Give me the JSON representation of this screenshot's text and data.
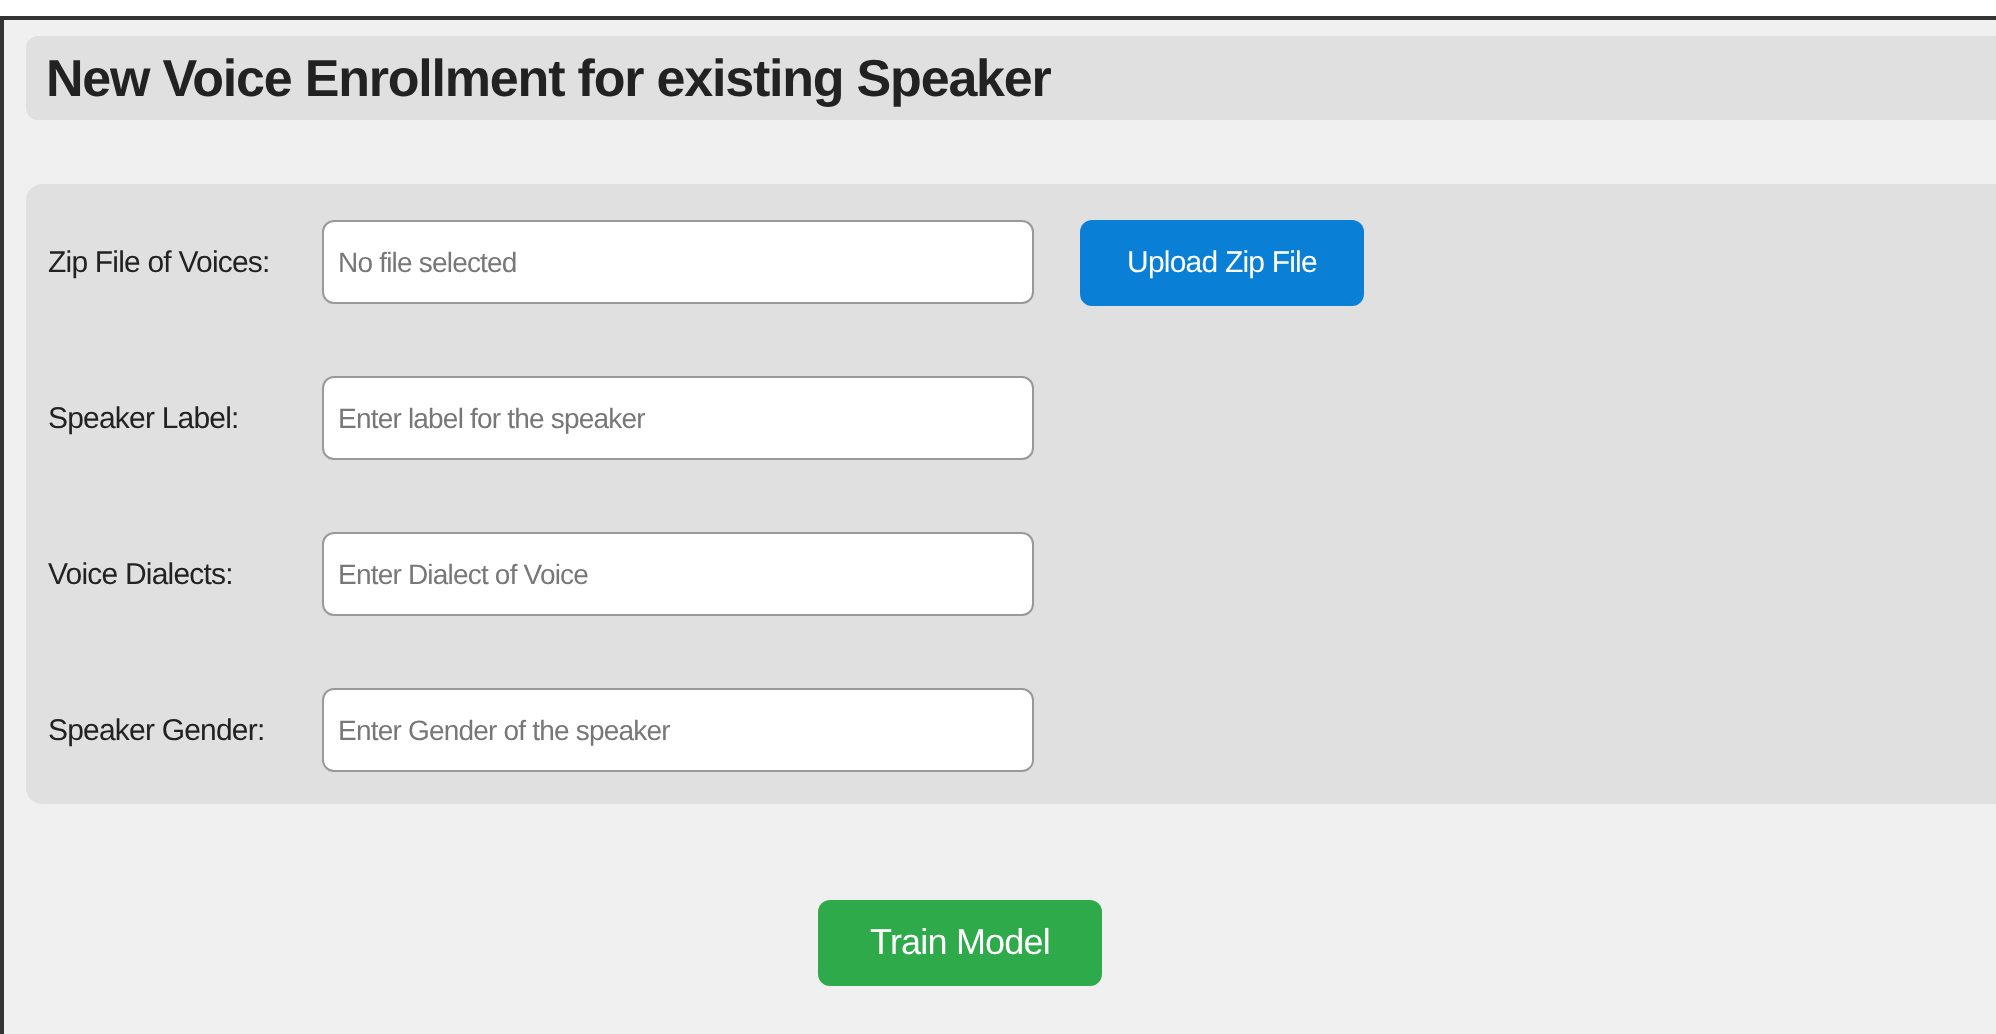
{
  "title": "New Voice Enrollment for existing Speaker",
  "fields": [
    {
      "label": "Zip File of Voices:",
      "placeholder": "No file selected",
      "button": "Upload Zip File"
    },
    {
      "label": "Speaker Label:",
      "placeholder": "Enter label for the speaker"
    },
    {
      "label": "Voice Dialects:",
      "placeholder": "Enter Dialect of Voice"
    },
    {
      "label": "Speaker Gender:",
      "placeholder": "Enter Gender of the speaker"
    }
  ],
  "submit": "Train Model"
}
